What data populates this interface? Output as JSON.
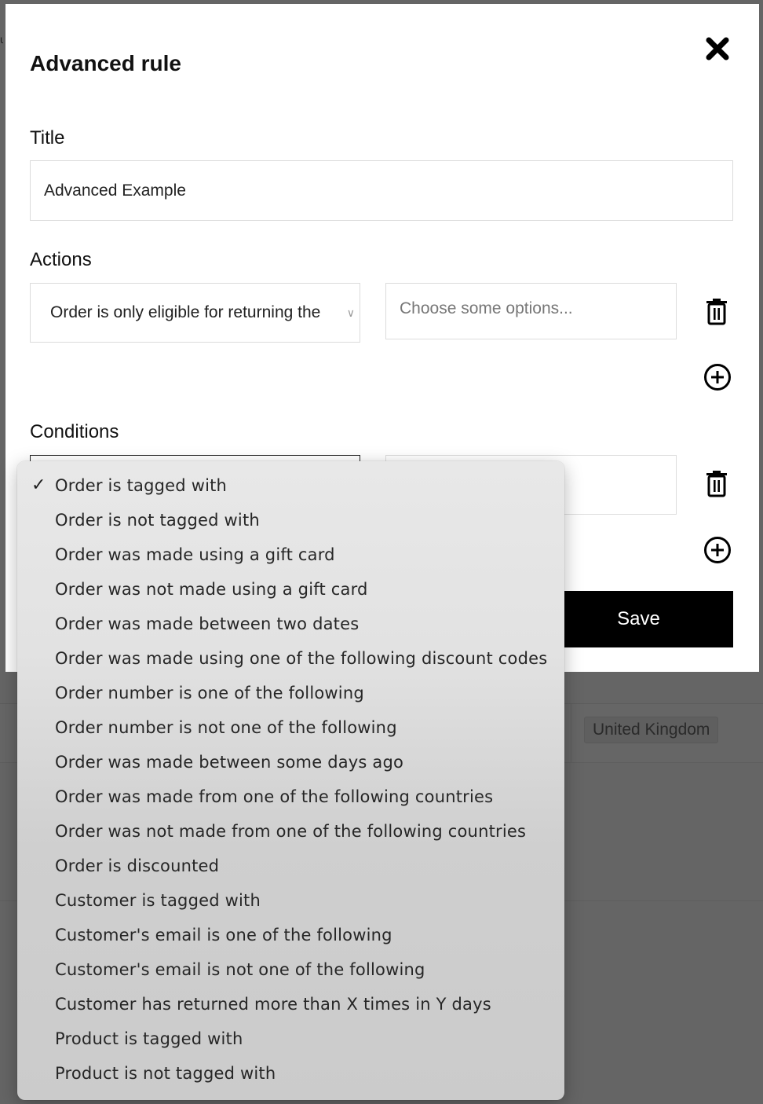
{
  "background": {
    "tag_label": "United Kingdom"
  },
  "modal": {
    "title": "Advanced rule",
    "close_icon": "close-icon",
    "title_section": {
      "label": "Title",
      "value": "Advanced Example"
    },
    "actions_section": {
      "label": "Actions",
      "selected_action": "Order is only eligible for returning the",
      "options_placeholder": "Choose some options...",
      "delete_icon": "trash-icon",
      "add_icon": "plus-circle-icon"
    },
    "conditions_section": {
      "label": "Conditions",
      "delete_icon": "trash-icon",
      "add_icon": "plus-circle-icon"
    },
    "save_label": "Save"
  },
  "condition_dropdown": {
    "check_glyph": "✓",
    "selected_index": 0,
    "options": [
      "Order is tagged with",
      "Order is not tagged with",
      "Order was made using a gift card",
      "Order was not made using a gift card",
      "Order was made between two dates",
      "Order was made using one of the following discount codes",
      "Order number is one of the following",
      "Order number is not one of the following",
      "Order was made between some days ago",
      "Order was made from one of the following countries",
      "Order was not made from one of the following countries",
      "Order is discounted",
      "Customer is tagged with",
      "Customer's email is one of the following",
      "Customer's email is not one of the following",
      "Customer has returned more than X times in Y days",
      "Product is tagged with",
      "Product is not tagged with"
    ]
  }
}
